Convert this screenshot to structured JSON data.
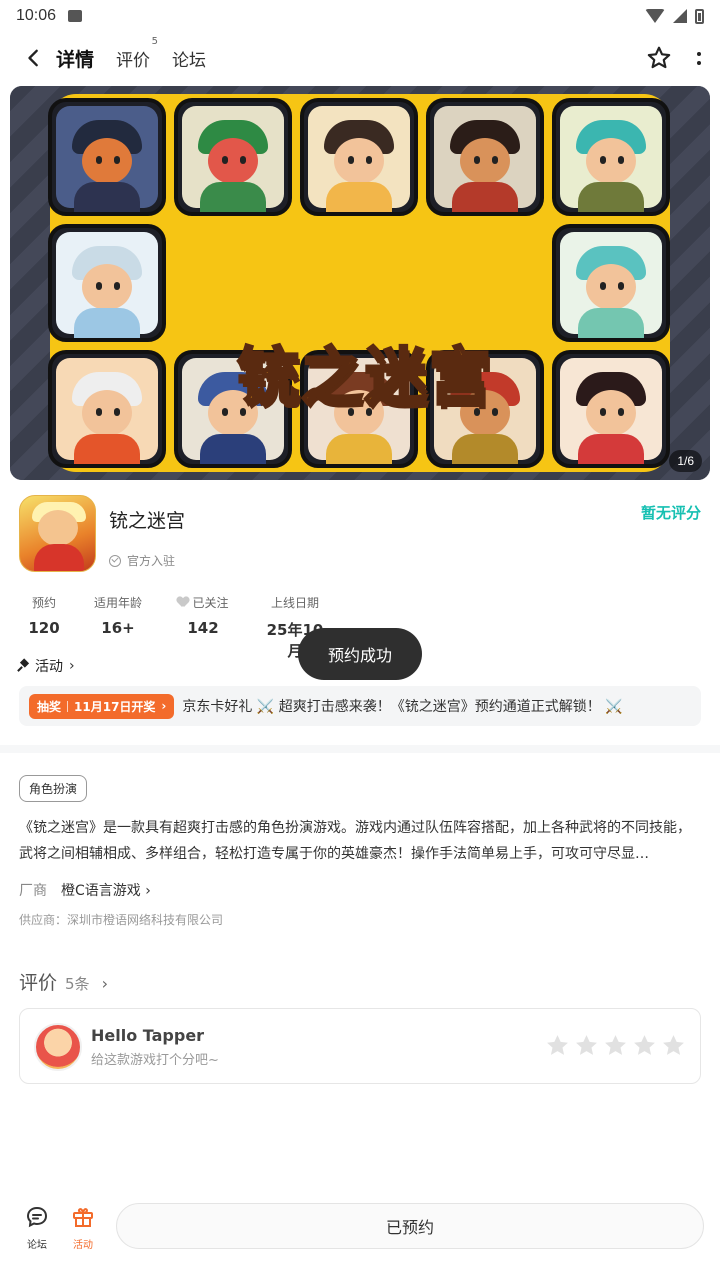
{
  "status_bar": {
    "time": "10:06"
  },
  "nav": {
    "tabs": [
      {
        "label": "详情"
      },
      {
        "label": "评价",
        "badge": "5"
      },
      {
        "label": "论坛"
      }
    ]
  },
  "banner": {
    "title_art": "铳之迷宫",
    "pager": "1/6"
  },
  "game": {
    "title": "铳之迷宫",
    "official": "官方入驻",
    "rating": "暂无评分"
  },
  "stats": [
    {
      "label": "预约",
      "value": "120"
    },
    {
      "label": "适用年龄",
      "value": "16+"
    },
    {
      "label": "已关注",
      "value": "142"
    },
    {
      "label": "上线日期",
      "value": "25年10月"
    }
  ],
  "toast": "预约成功",
  "activity": {
    "header": "活动",
    "badge_type": "抽奖",
    "badge_date": "11月17日开奖",
    "text": "京东卡好礼 ⚔️ 超爽打击感来袭！《铳之迷宫》预约通道正式解锁！ ⚔️"
  },
  "details": {
    "tag": "角色扮演",
    "description": "《铳之迷宫》是一款具有超爽打击感的角色扮演游戏。游戏内通过队伍阵容搭配，加上各种武将的不同技能，武将之间相辅相成、多样组合，轻松打造专属于你的英雄豪杰！操作手法简单易上手，可攻可守尽显…",
    "vendor_label": "厂商",
    "vendor": "橙C语言游戏",
    "supplier": "供应商：深圳市橙语网络科技有限公司"
  },
  "reviews": {
    "title": "评价",
    "count": "5条",
    "user": "Hello Tapper",
    "hint": "给这款游戏打个分吧~"
  },
  "bottom": {
    "forum": "论坛",
    "activity": "活动",
    "reserve": "已预约"
  },
  "colors": {
    "accent": "#16c0b2",
    "orange": "#f36b2b",
    "banner_yellow": "#f6c514"
  }
}
